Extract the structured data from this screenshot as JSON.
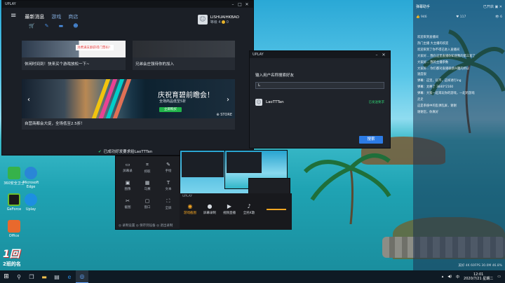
{
  "main_window": {
    "title": "UPLAY",
    "tabs": [
      {
        "label": "最新消息",
        "active": true
      },
      {
        "label": "游戏",
        "active": false
      },
      {
        "label": "商店",
        "active": false
      }
    ],
    "sub_icons": [
      "cart-icon",
      "wrench-icon",
      "chat-icon",
      "friends-icon"
    ],
    "profile": {
      "username": "LISHUAIHKBAO",
      "level_label": "等级 4",
      "coins": "0"
    },
    "cards": [
      {
        "caption": "休闲时间到！快来买个游戏放松一下~",
        "tag": "消费满支额获得门票码！"
      },
      {
        "caption": "兄弟会庄强待你的加入"
      },
      {
        "caption": "自营商都会大促，全场低至2.5折！",
        "promo_title": "庆祝育碧前瞻会！",
        "promo_sub": "全场商品低至5折",
        "promo_button": "立即购买",
        "store_label": "STORE"
      }
    ]
  },
  "toast": {
    "text": "已成功好发要求给LaoTTTan"
  },
  "dialog": {
    "title": "UPLAY",
    "background_title": "■ 庄 开战时间限",
    "label": "输入用户名称搜索好友",
    "input_value": "L",
    "result": {
      "name": "LaoTTTan",
      "status": "已发送要求"
    },
    "search_button": "搜索"
  },
  "capture_tools": [
    {
      "label": "屏幕录",
      "icon": "screen-icon"
    },
    {
      "label": "抓取",
      "icon": "crop-icon"
    },
    {
      "label": "手绘",
      "icon": "pen-icon"
    },
    {
      "label": "图像",
      "icon": "image-icon"
    },
    {
      "label": "马赛",
      "icon": "mosaic-icon"
    },
    {
      "label": "文本",
      "icon": "text-icon"
    },
    {
      "label": "截图",
      "icon": "scissor-icon"
    },
    {
      "label": "窗口",
      "icon": "window-icon"
    },
    {
      "label": "全屏",
      "icon": "fullscreen-icon"
    }
  ],
  "capture_footer": "◎ 录制设置    ◎ 保存到设备    ◎ 退出录制",
  "game_strip": {
    "title": "UPLAY",
    "buttons": [
      {
        "label": "游戏截图",
        "selected": true
      },
      {
        "label": "屏幕录制",
        "selected": false
      },
      {
        "label": "视频直播",
        "selected": false
      },
      {
        "label": "全民K歌",
        "selected": false
      }
    ]
  },
  "chat": {
    "header": "弹幕助手",
    "header_right": "已开启 ▣ ✕",
    "stats": [
      "👍 946",
      "♥ 117",
      "👁 6"
    ],
    "lines": [
      "欢迎来到直播间",
      "热门主播 大主播的欢迎",
      "欢迎来到了你不得已进入直播间",
      "大家好... 我在这里直播你知道我的第三套了",
      "大家好... 我的主播参数",
      "大家好... 你们都对直播很感兴趣的所以",
      "速度很",
      "弹幕：这里，玩不，这样进行ing",
      "弹幕：太棒了 3840*2160",
      "弹幕：大家一起来玩你的游戏，一起的游戏",
      "走走",
      "这是系统中的乱弹乱屏，谢谢",
      "谢谢您，你真好"
    ],
    "footer": "美好 4K 60FPS 30.0M 46.8%"
  },
  "desktop_icons": [
    {
      "label": "360安全卫士",
      "color": "#36b24a"
    },
    {
      "label": "Microsoft Edge",
      "color": "#2a86d6"
    },
    {
      "label": "GeForce",
      "color": "#6bbd2d"
    },
    {
      "label": "Uplay",
      "color": "#1d8fe1"
    },
    {
      "label": "Office",
      "color": "#e8692d"
    }
  ],
  "desktop_logo": {
    "line1": "1回",
    "line2": "2班的名"
  },
  "taskbar": {
    "start_icon": "windows-icon",
    "items": [
      "search-icon",
      "task-view-icon",
      "file-explorer-icon",
      "store-icon",
      "edge-icon",
      "uplay-icon"
    ],
    "clock_time": "12:01",
    "clock_date": "2020/7/21 星期二",
    "tray_label": "中"
  }
}
